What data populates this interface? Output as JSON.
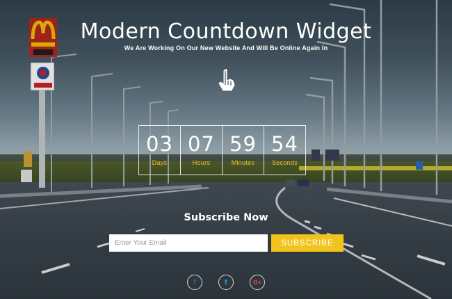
{
  "header": {
    "title": "Modern Countdown Widget",
    "subtitle": "We Are Working On Our New Website And Will Be Online Again In"
  },
  "logos": {
    "mcdonalds": "McDONALD'S",
    "lotos": "LOTOS"
  },
  "countdown": {
    "units": [
      {
        "value": "03",
        "label": "Days"
      },
      {
        "value": "07",
        "label": "Hours"
      },
      {
        "value": "59",
        "label": "Minutes"
      },
      {
        "value": "54",
        "label": "Seconds"
      }
    ]
  },
  "subscribe": {
    "title": "Subscribe Now",
    "email_placeholder": "Enter Your Email",
    "button_label": "SUBSCRIBE"
  },
  "social": [
    {
      "name": "facebook",
      "glyph": "f"
    },
    {
      "name": "twitter",
      "glyph": "t"
    },
    {
      "name": "google-plus",
      "glyph": "G+"
    }
  ],
  "colors": {
    "accent": "#f1c31d",
    "text": "#ffffff",
    "input_bg": "#ffffff"
  }
}
